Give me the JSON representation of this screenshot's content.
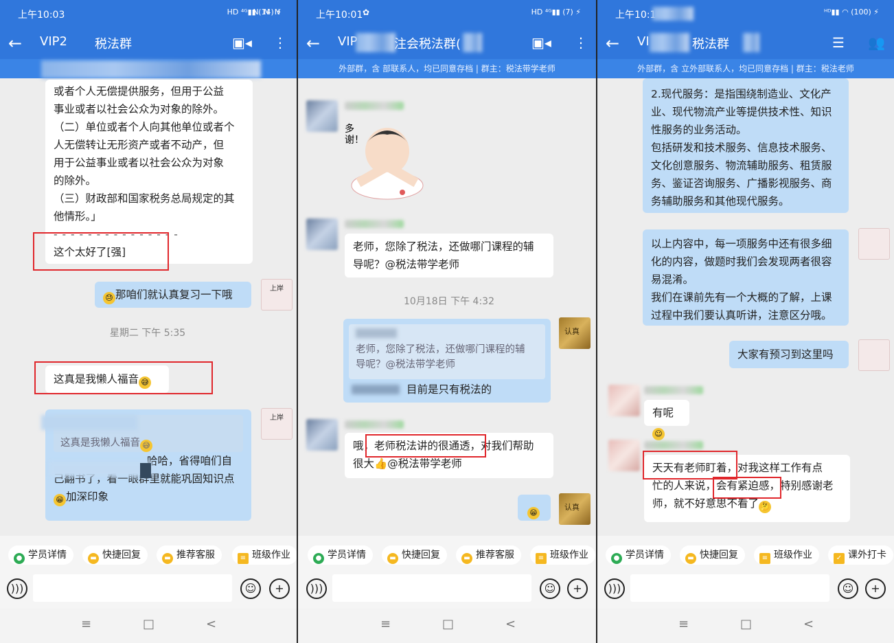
{
  "panels": [
    {
      "status_time": "上午10:03",
      "group_title_left": "VIP2",
      "group_title_right": "税法群",
      "messages": {
        "m1_lines": [
          "或者个人无偿提供服务，但用于公益",
          "事业或者以社会公众为对象的除外。",
          "（二）单位或者个人向其他单位或者个",
          "人无偿转让无形资产或者不动产，但",
          "用于公益事业或者以社会公众为对象",
          "的除外。",
          "（三）财政部和国家税务总局规定的其",
          "他情形。」"
        ],
        "m1_divider": "- - - - - - - - - - - - - - -",
        "m1_reply": "这个太好了[强]",
        "m2": "那咱们就认真复习一下哦",
        "timestamp": "星期二 下午 5:35",
        "m3": "这真是我懒人福音",
        "m4_quote": "这真是我懒人福音",
        "m4_lines": [
          "哈哈，省得咱们自",
          "己翻书了，看一眼群里就能巩固知识点",
          "加深印象"
        ]
      },
      "quick": [
        "学员详情",
        "快捷回复",
        "推荐客服",
        "班级作业"
      ],
      "sticker_label": "上岸"
    },
    {
      "status_time": "上午10:01",
      "group_title_left": "VIP",
      "group_title_right": "注会税法群(",
      "subbar": "外部群，含          部联系人，均已同意存档 | 群主：税法带学老师",
      "messages": {
        "m1": [
          "老师，您除了税法，还做哪门课程的辅",
          "导呢？@税法带学老师"
        ],
        "timestamp": "10月18日  下午 4:32",
        "m2_quote": [
          "老师，您除了税法，还做哪门课程的辅",
          "导呢？@税法带学老师"
        ],
        "m2_reply": "目前是只有税法的",
        "m3_pre": "哦，",
        "m3_highlight": "老师税法讲的很通透，",
        "m3_post": "对我们帮助",
        "m3_line2": "很大👍@税法带学老师"
      },
      "sticker_text": "多谢！",
      "avatar_text": "认真",
      "quick": [
        "学员详情",
        "快捷回复",
        "推荐客服",
        "班级作业"
      ]
    },
    {
      "status_time": "上午10:1",
      "group_title_left": "VI",
      "group_title_right": "税法群",
      "subbar": "外部群，含     立外部联系人，均已同意存档 | 群主：税法老师",
      "messages": {
        "m1_lines": [
          "2.现代服务：是指围绕制造业、文化产",
          "业、现代物流产业等提供技术性、知识",
          "性服务的业务活动。",
          "包括研发和技术服务、信息技术服务、",
          "文化创意服务、物流辅助服务、租赁服",
          "务、鉴证咨询服务、广播影视服务、商",
          "务辅助服务和其他现代服务。"
        ],
        "m2_lines": [
          "以上内容中，每一项服务中还有很多细",
          "化的内容，做题时我们会发现两者很容",
          "易混淆。",
          "我们在课前先有一个大概的了解，上课",
          "过程中我们要认真听讲，注意区分哦。"
        ],
        "m3": "大家有预习到这里吗",
        "m4": "有呢",
        "m5_highlight1": "天天有老师盯着，",
        "m5_line1_rest": "对我这样工作有点",
        "m5_line2_pre": "忙的人来说，",
        "m5_highlight2": "会有紧迫感，",
        "m5_line2_post": "特别感谢老",
        "m5_line3": "师，就不好意思不看了"
      },
      "quick": [
        "学员详情",
        "快捷回复",
        "班级作业",
        "课外打卡"
      ]
    }
  ],
  "nav": {
    "menu": "≡",
    "home": "□",
    "back": "<"
  }
}
